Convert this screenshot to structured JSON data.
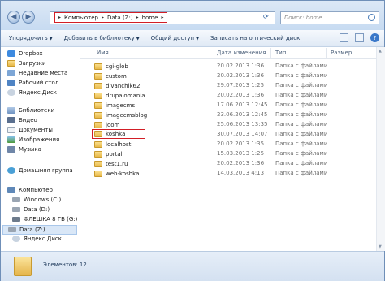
{
  "address": {
    "segments": [
      "Компьютер",
      "Data (Z:)",
      "home"
    ]
  },
  "search": {
    "placeholder": "Поиск: home"
  },
  "toolbar": {
    "organize": "Упорядочить",
    "add_library": "Добавить в библиотеку",
    "share": "Общий доступ",
    "burn": "Записать на оптический диск"
  },
  "sidebar": {
    "dropbox": "Dropbox",
    "downloads": "Загрузки",
    "recent": "Недавние места",
    "desktop": "Рабочий стол",
    "yadisk1": "Яндекс.Диск",
    "libraries": "Библиотеки",
    "video": "Видео",
    "documents": "Документы",
    "images": "Изображения",
    "music": "Музыка",
    "homegroup": "Домашняя группа",
    "computer": "Компьютер",
    "win_c": "Windows (C:)",
    "data_d": "Data (D:)",
    "usb_g": "ФЛЕШКА 8 ГБ (G:)",
    "data_z": "Data (Z:)",
    "yadisk2": "Яндекс.Диск"
  },
  "columns": {
    "name": "Имя",
    "date": "Дата изменения",
    "type": "Тип",
    "size": "Размер"
  },
  "files": [
    {
      "name": "cgi-glob",
      "date": "20.02.2013 1:36",
      "type": "Папка с файлами"
    },
    {
      "name": "custom",
      "date": "20.02.2013 1:36",
      "type": "Папка с файлами"
    },
    {
      "name": "divanchik62",
      "date": "29.07.2013 1:25",
      "type": "Папка с файлами"
    },
    {
      "name": "drupalomania",
      "date": "20.02.2013 1:36",
      "type": "Папка с файлами"
    },
    {
      "name": "imagecms",
      "date": "17.06.2013 12:45",
      "type": "Папка с файлами"
    },
    {
      "name": "imagecmsblog",
      "date": "23.06.2013 12:45",
      "type": "Папка с файлами"
    },
    {
      "name": "joom",
      "date": "25.06.2013 13:35",
      "type": "Папка с файлами"
    },
    {
      "name": "koshka",
      "date": "30.07.2013 14:07",
      "type": "Папка с файлами"
    },
    {
      "name": "localhost",
      "date": "20.02.2013 1:35",
      "type": "Папка с файлами"
    },
    {
      "name": "portal",
      "date": "15.03.2013 1:25",
      "type": "Папка с файлами"
    },
    {
      "name": "test1.ru",
      "date": "20.02.2013 1:36",
      "type": "Папка с файлами"
    },
    {
      "name": "web-koshka",
      "date": "14.03.2013 4:13",
      "type": "Папка с файлами"
    }
  ],
  "status": {
    "count": "Элементов: 12"
  }
}
